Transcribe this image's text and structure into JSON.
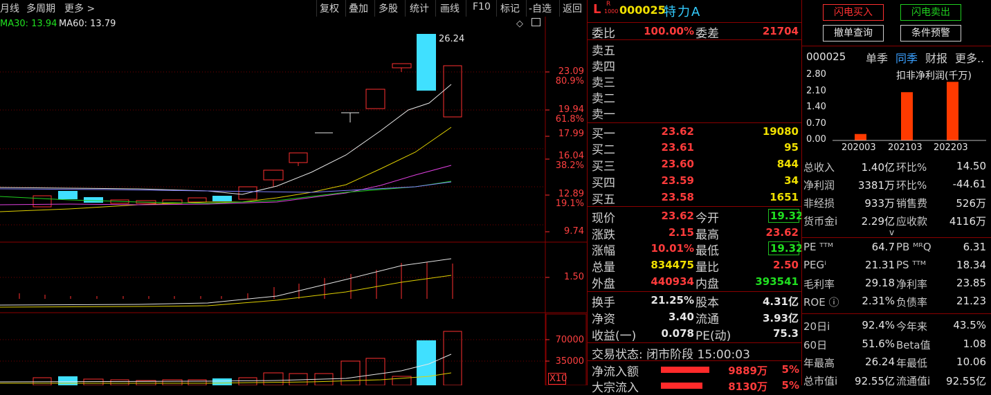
{
  "toolbar": {
    "items": [
      "月线",
      "多周期",
      "更多 >",
      "复权",
      "叠加",
      "多股",
      "统计",
      "画线",
      "F10",
      "标记",
      "-自选",
      "返回"
    ]
  },
  "ma_legend": {
    "ma30": "MA30: 13.94",
    "ma60": "MA60: 13.79"
  },
  "chart": {
    "price_labels": [
      "23.09",
      "80.9%",
      "19.94",
      "61.8%",
      "17.99",
      "16.04",
      "38.2%",
      "12.89",
      "19.1%",
      "9.74"
    ],
    "high_label": "26.24",
    "vol_axis": "1.50",
    "volume_labels": [
      "70000",
      "35000",
      "X10"
    ]
  },
  "quote": {
    "prefix": "L",
    "sup": "R",
    "sub": "1000",
    "code": "000025",
    "name": "特力A",
    "weibi_label": "委比",
    "weibi_value": "100.00%",
    "weicha_label": "委差",
    "weicha_value": "21704",
    "sell_levels": [
      "卖五",
      "卖四",
      "卖三",
      "卖二",
      "卖一"
    ],
    "buy_levels": [
      {
        "label": "买一",
        "price": "23.62",
        "vol": "19080"
      },
      {
        "label": "买二",
        "price": "23.61",
        "vol": "95"
      },
      {
        "label": "买三",
        "price": "23.60",
        "vol": "844"
      },
      {
        "label": "买四",
        "price": "23.59",
        "vol": "34"
      },
      {
        "label": "买五",
        "price": "23.58",
        "vol": "1651"
      }
    ],
    "stats": [
      {
        "l1": "现价",
        "v1": "23.62",
        "l2": "今开",
        "v2": "19.32"
      },
      {
        "l1": "涨跌",
        "v1": "2.15",
        "l2": "最高",
        "v2": "23.62"
      },
      {
        "l1": "涨幅",
        "v1": "10.01%",
        "l2": "最低",
        "v2": "19.32"
      },
      {
        "l1": "总量",
        "v1": "834475",
        "l2": "量比",
        "v2": "2.50"
      },
      {
        "l1": "外盘",
        "v1": "440934",
        "l2": "内盘",
        "v2": "393541"
      }
    ],
    "stats2": [
      {
        "l1": "换手",
        "v1": "21.25%",
        "l2": "股本",
        "v2": "4.31亿"
      },
      {
        "l1": "净资",
        "v1": "3.40",
        "l2": "流通",
        "v2": "3.93亿"
      },
      {
        "l1": "收益(一)",
        "v1": "0.078",
        "l2": "PE(动)",
        "v2": "75.3"
      }
    ],
    "trade_status": "交易状态: 闭市阶段 15:00:03",
    "flows": [
      {
        "label": "净流入额",
        "value": "9889万",
        "pct": "5%"
      },
      {
        "label": "大宗流入",
        "value": "8130万",
        "pct": "5%"
      }
    ]
  },
  "far_right": {
    "buttons": [
      "闪电买入",
      "闪电卖出",
      "撤单查询",
      "条件预警"
    ],
    "code": "000025",
    "tabs": [
      "单季",
      "同季",
      "财报",
      "更多.."
    ],
    "fin_title": "扣非净利润(千万)",
    "fin_y": [
      "2.80",
      "2.10",
      "1.40",
      "0.70",
      "0.00"
    ],
    "fin_x": [
      "202003",
      "202103",
      "202203"
    ],
    "fin_values": [
      0.28,
      2.1,
      2.55
    ],
    "rows": [
      {
        "l1": "总收入",
        "v1": "1.40亿",
        "l2": "环比%",
        "v2": "14.50"
      },
      {
        "l1": "净利润",
        "v1": "3381万",
        "l2": "环比%",
        "v2": "-44.61"
      },
      {
        "l1": "非经损",
        "v1": "933万",
        "l2": "销售费",
        "v2": "526万"
      },
      {
        "l1": "货币金i",
        "v1": "2.29亿",
        "l2": "应收款",
        "v2": "4116万"
      }
    ],
    "chevron": "v",
    "rows2": [
      {
        "l1": "PE ᵀᵀᴹ",
        "v1": "64.7",
        "l2": "PB ᴹᴿQ",
        "v2": "6.31"
      },
      {
        "l1": "PEGⁱ",
        "v1": "21.31",
        "l2": "PS ᵀᵀᴹ",
        "v2": "18.34"
      },
      {
        "l1": "毛利率",
        "v1": "29.18",
        "l2": "净利率",
        "v2": "23.85"
      },
      {
        "l1": "ROE ⓘ",
        "v1": "2.31%",
        "l2": "负债率",
        "v2": "21.23"
      }
    ],
    "rows3": [
      {
        "l1": "20日i",
        "v1": "92.4%",
        "l2": "今年来",
        "v2": "43.5%"
      },
      {
        "l1": "60日",
        "v1": "51.6%",
        "l2": "Beta值",
        "v2": "1.08"
      },
      {
        "l1": "年最高",
        "v1": "26.24",
        "l2": "年最低",
        "v2": "10.06"
      },
      {
        "l1": "总市值i",
        "v1": "92.55亿",
        "l2": "流通值i",
        "v2": "92.55亿"
      }
    ]
  }
}
